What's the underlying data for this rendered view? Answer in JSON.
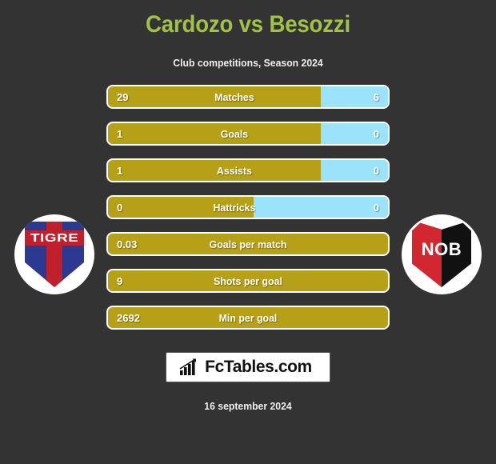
{
  "header": {
    "title": "Cardozo vs Besozzi",
    "subtitle": "Club competitions, Season 2024",
    "title_color": "#A2C246"
  },
  "teams": {
    "home": {
      "crest_name": "tigre-crest",
      "crest_text": "TIGRE"
    },
    "away": {
      "crest_name": "newells-old-boys-crest",
      "crest_text": "NOB"
    }
  },
  "colors": {
    "background": "#333333",
    "home_bar": "#B5A017",
    "away_bar": "#9BE3FB",
    "bar_border": "#FFFFFF"
  },
  "stats": [
    {
      "label": "Matches",
      "home": "29",
      "away": "6",
      "home_pct": 76,
      "split": true
    },
    {
      "label": "Goals",
      "home": "1",
      "away": "0",
      "home_pct": 76,
      "split": true
    },
    {
      "label": "Assists",
      "home": "1",
      "away": "0",
      "home_pct": 76,
      "split": true
    },
    {
      "label": "Hattricks",
      "home": "0",
      "away": "0",
      "home_pct": 52,
      "split": true
    },
    {
      "label": "Goals per match",
      "home": "0.03",
      "away": "",
      "home_pct": 100,
      "split": false
    },
    {
      "label": "Shots per goal",
      "home": "9",
      "away": "",
      "home_pct": 100,
      "split": false
    },
    {
      "label": "Min per goal",
      "home": "2692",
      "away": "",
      "home_pct": 100,
      "split": false
    }
  ],
  "footer": {
    "brand_text": "FcTables.com",
    "brand_icon": "bar-chart-growth-icon",
    "date": "16 september 2024"
  }
}
